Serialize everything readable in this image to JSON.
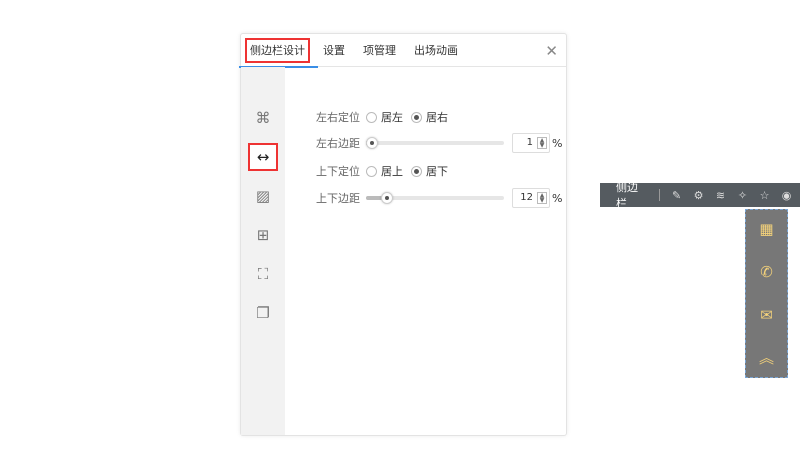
{
  "tabs": [
    "侧边栏设计",
    "设置",
    "项管理",
    "出场动画"
  ],
  "close_label": "✕",
  "side_icons": [
    "layout-icon",
    "margin-icon",
    "background-icon",
    "border-icon",
    "fullscreen-icon",
    "shadow-icon"
  ],
  "form": {
    "h_position": {
      "label": "左右定位",
      "options": [
        "居左",
        "居右"
      ],
      "selected": "居右"
    },
    "h_margin": {
      "label": "左右边距",
      "value": "1",
      "percent": 1,
      "unit": "%"
    },
    "v_position": {
      "label": "上下定位",
      "options": [
        "居上",
        "居下"
      ],
      "selected": "居下"
    },
    "v_margin": {
      "label": "上下边距",
      "value": "12",
      "percent": 12,
      "unit": "%"
    }
  },
  "toolbar": {
    "title": "侧边栏"
  },
  "colors": {
    "accent": "#3a8ee6",
    "highlight": "#ee3333",
    "widget_bg": "#777777",
    "widget_icon": "#f4d27a"
  }
}
